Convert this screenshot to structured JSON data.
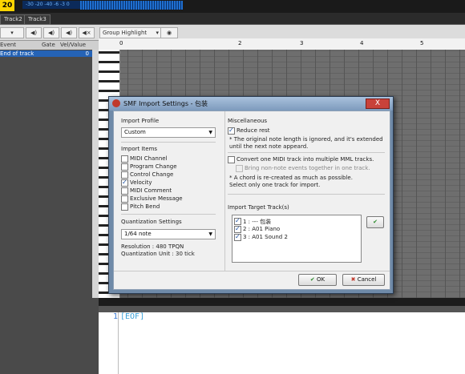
{
  "topbar": {
    "counter": "20",
    "level_text": "-30 -20 -40 -6 -3 0"
  },
  "tabs": [
    "Track2",
    "Track3"
  ],
  "toolbar": {
    "group_highlight": "Group Highlight"
  },
  "columns": {
    "event": "Event",
    "gate": "Gate",
    "velvalue": "Vel/Value"
  },
  "event_rows": [
    {
      "name": "End of track",
      "value": "0"
    }
  ],
  "ruler": [
    "0",
    "2",
    "3",
    "4",
    "5"
  ],
  "editor": {
    "line_no": "1",
    "text": "[EOF]"
  },
  "dialog": {
    "title": "SMF Import Settings - 包装",
    "close": "X",
    "import_profile": {
      "label": "Import Profile",
      "value": "Custom"
    },
    "import_items": {
      "label": "Import Items",
      "items": [
        {
          "label": "MIDI Channel",
          "checked": false
        },
        {
          "label": "Program Change",
          "checked": false
        },
        {
          "label": "Control Change",
          "checked": false
        },
        {
          "label": "Velocity",
          "checked": true
        },
        {
          "label": "MIDI Comment",
          "checked": false
        },
        {
          "label": "Exclusive Message",
          "checked": false
        },
        {
          "label": "Pitch Bend",
          "checked": false
        }
      ]
    },
    "quantization": {
      "label": "Quantization Settings",
      "value": "1/64 note",
      "resolution": "Resolution : 480 TPQN",
      "unit": "Quantization Unit : 30 tick"
    },
    "misc": {
      "label": "Miscellaneous",
      "reduce_rest": "Reduce rest",
      "reduce_note1": "* The original note length is ignored, and it's extended",
      "reduce_note2": "until the next note appeard.",
      "convert": "Convert one MIDI track into multiple MML tracks.",
      "bring": "Bring non-note events together in one track.",
      "chord_note1": "* A chord is re-created as much as possible.",
      "chord_note2": "Select only one track for import."
    },
    "target": {
      "label": "Import Target Track(s)",
      "tracks": [
        {
          "label": "1 : ---    包装",
          "checked": true
        },
        {
          "label": "2 : A01 Piano",
          "checked": true
        },
        {
          "label": "3 : A01 Sound 2",
          "checked": true
        }
      ]
    },
    "ok": "OK",
    "cancel": "Cancel"
  }
}
